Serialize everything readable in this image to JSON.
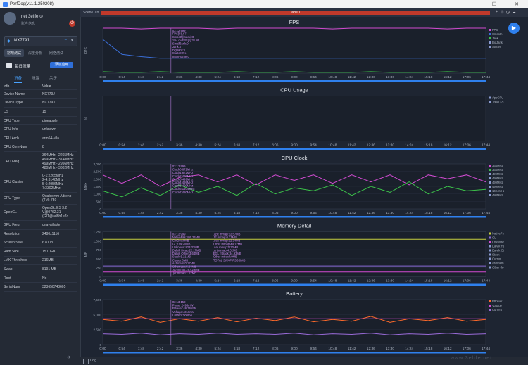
{
  "window": {
    "title": "PerfDog(v11.1.250208)",
    "controls": [
      "—",
      "☐",
      "✕"
    ]
  },
  "user": {
    "name": "net 3elife ⊙",
    "subtitle": "账户信息",
    "logout_icon": "⏻"
  },
  "device": {
    "name": "NX779J",
    "icon": "◆",
    "wifi_icon": "≈",
    "chevron": "▼"
  },
  "mode_tabs": [
    "常规测试",
    "深度分析",
    "网络测试"
  ],
  "app": {
    "name": "每日流量",
    "button": "添加应用"
  },
  "info_tabs": [
    "设备",
    "设置",
    "关于"
  ],
  "info_table": {
    "header": [
      "Info",
      "Value"
    ],
    "rows": [
      [
        "Device Name",
        "NX779J"
      ],
      [
        "Device Type",
        "NX779J"
      ],
      [
        "OS",
        "15"
      ],
      [
        "CPU Type",
        "pineapple"
      ],
      [
        "CPU Info",
        "unknown"
      ],
      [
        "CPU Arch",
        "arm64-v8a"
      ],
      [
        "CPU CoreNum",
        "8"
      ],
      [
        "CPU Freq",
        "364MHz - 2265MHz\n499MHz - 3148MHz\n499MHz - 2956MHz\n480MHz - 3302MHz"
      ],
      [
        "CPU Cluster",
        "0-1:2265MHz\n2-4:3148MHz\n5-6:2956MHz\n7:3302MHz"
      ],
      [
        "GPU Type",
        "Qualcomm Adreno\n(TM) 750"
      ],
      [
        "OpenGL",
        "OpenGL ES 3.2\nV@0762.31\n(GIT@ad8b1e7c"
      ],
      [
        "GPU Freq",
        "unavailable"
      ],
      [
        "Resolution",
        "2480x1116"
      ],
      [
        "Screen Size",
        "6.81 in"
      ],
      [
        "Ram Size",
        "15.0 GB"
      ],
      [
        "LMK Threshold",
        "216MB"
      ],
      [
        "Swap",
        "8191 MB"
      ],
      [
        "Root",
        "No"
      ],
      [
        "SerialNum",
        "323650743605"
      ]
    ]
  },
  "topbar": {
    "scene_tab": "SceneTab",
    "label": "label1"
  },
  "bottom": {
    "log_label": "Log"
  },
  "watermark": "www.3elife.net",
  "colors": {
    "accent": "#2f80ed",
    "label_bar": "#c0392b",
    "fps_line": "#d24bd2",
    "bg": "#1e2532"
  },
  "chart_data": [
    {
      "type": "line",
      "title": "FPS",
      "ylabel": "FPS",
      "ylim": [
        0,
        60
      ],
      "x": [
        "0:00",
        "0:54",
        "1:48",
        "2:42",
        "3:36",
        "4:30",
        "5:24",
        "6:18",
        "7:12",
        "8:06",
        "9:00",
        "9:54",
        "10:48",
        "11:42",
        "12:36",
        "13:30",
        "14:24",
        "15:18",
        "16:12",
        "17:06",
        "17:44"
      ],
      "series": [
        {
          "name": "FPS",
          "color": "#d24bd2",
          "values": [
            60,
            60,
            59,
            60,
            60,
            60,
            59,
            60,
            60,
            60,
            60,
            60,
            59,
            60,
            60,
            60,
            60,
            60,
            59,
            60,
            60
          ]
        },
        {
          "name": "Smooth",
          "color": "#3b6fd8",
          "values": [
            45,
            25,
            22,
            20,
            20,
            20,
            20,
            20,
            20,
            20,
            20,
            20,
            20,
            20,
            20,
            20,
            20,
            20,
            20,
            20,
            20
          ]
        },
        {
          "name": "Jank",
          "color": "#3cc34a",
          "values": [
            2,
            1,
            1,
            2,
            1,
            1,
            1,
            2,
            1,
            1,
            2,
            1,
            1,
            1,
            2,
            1,
            1,
            1,
            2,
            1,
            1
          ]
        }
      ],
      "legend": [
        "FPS",
        "Smooth",
        "Jank",
        "BigJank",
        "Stutter"
      ],
      "readout": [
        "03:12:999",
        "FPS[58.67",
        "Smooth[Index]:0",
        "1%LowFPS[1]:31.86",
        "SmallJank:0",
        "Jank:0",
        "BigJank:0",
        "Stutter:0%",
        "InterFrame:0"
      ]
    },
    {
      "type": "line",
      "title": "CPU Usage",
      "ylabel": "%",
      "x": [
        "0:00",
        "0:54",
        "1:48",
        "2:42",
        "3:36",
        "4:30",
        "5:24",
        "6:18",
        "7:12",
        "8:06",
        "9:00",
        "9:54",
        "10:48",
        "11:42",
        "12:36",
        "13:30",
        "14:24",
        "15:18",
        "16:12",
        "17:06",
        "17:44"
      ],
      "series": [],
      "legend": [
        "AppCPU",
        "TotalCPU"
      ]
    },
    {
      "type": "line",
      "title": "CPU Clock",
      "ylabel": "MHz",
      "ylim": [
        0,
        3000
      ],
      "yticks": [
        "3,000",
        "2,500",
        "2,000",
        "1,500",
        "1,000",
        "500",
        "0"
      ],
      "x": [
        "0:00",
        "0:54",
        "1:48",
        "2:42",
        "3:36",
        "4:30",
        "5:24",
        "6:18",
        "7:12",
        "8:06",
        "9:00",
        "9:54",
        "10:48",
        "11:42",
        "12:36",
        "13:30",
        "14:24",
        "15:18",
        "16:12",
        "17:06",
        "17:44"
      ],
      "series": [
        {
          "name": "CPU0",
          "color": "#d24bd2",
          "values": [
            2265,
            1700,
            2265,
            1500,
            2100,
            2265,
            1800,
            2265,
            1600,
            2265,
            1900,
            2265,
            1700,
            2265,
            1800,
            2265,
            1600,
            2265,
            2000,
            2265,
            1800
          ]
        },
        {
          "name": "CPU2",
          "color": "#3cc34a",
          "values": [
            1200,
            800,
            1400,
            900,
            1600,
            1100,
            1500,
            900,
            1700,
            1000,
            1400,
            1200,
            1600,
            900,
            1500,
            1100,
            1800,
            1000,
            1500,
            1200,
            1300
          ]
        }
      ],
      "legend": [
        "364MHz",
        "364MHz",
        "499MHz",
        "499MHz",
        "499MHz",
        "499MHz",
        "1404MHz",
        "480MHz"
      ],
      "readout": [
        "03:12:999",
        "Clock0:672MHz",
        "Clock1:672MHz",
        "Clock2:499MHz",
        "Clock3:499MHz",
        "Clock4:499MHz",
        "Clock5:499MHz",
        "Clock6:1404MHz",
        "Clock7:480MHz"
      ]
    },
    {
      "type": "line",
      "title": "Memory Detail",
      "ylabel": "MB",
      "ylim": [
        0,
        1250
      ],
      "yticks": [
        "1,250",
        "1,000",
        "750",
        "500",
        "250",
        "0"
      ],
      "x": [
        "0:00",
        "0:54",
        "1:48",
        "2:42",
        "3:36",
        "4:30",
        "5:24",
        "6:18",
        "7:12",
        "8:06",
        "9:00",
        "9:54",
        "10:48",
        "11:42",
        "12:36",
        "13:30",
        "14:24",
        "15:18",
        "16:12",
        "17:06",
        "17:44"
      ],
      "series": [
        {
          "name": "NativePss",
          "color": "#c8d040",
          "values": [
            1040,
            1040,
            1040,
            1040,
            1040,
            1040,
            1040,
            1040,
            1040,
            1040,
            1040,
            1040,
            1040,
            1040,
            1040,
            1040,
            1040,
            1040,
            1040,
            1040,
            1040
          ]
        },
        {
          "name": "GL",
          "color": "#8a6bd8",
          "values": [
            300,
            300,
            300,
            300,
            300,
            300,
            300,
            300,
            300,
            300,
            300,
            300,
            300,
            300,
            300,
            300,
            300,
            300,
            300,
            300,
            300
          ]
        },
        {
          "name": "Unknown",
          "color": "#d24bd2",
          "values": [
            130,
            130,
            130,
            130,
            130,
            130,
            130,
            130,
            130,
            130,
            130,
            130,
            130,
            130,
            130,
            130,
            130,
            130,
            130,
            130,
            130
          ]
        }
      ],
      "legend": [
        "NativePss",
        "GL",
        "Unknown",
        "Dalvik Heap",
        "Dalvik Other",
        "Stack",
        "Cursor",
        "Ashmem",
        "Other dev"
      ],
      "readout": [
        "03:12:999",
        "NativePss:105.24MB",
        "GfxDev:0MB",
        "GL:119.20MB",
        "Unknown:823.32MB",
        "Dalvik Heap:22.27MB",
        "Dalvik Other:3.64MB",
        "Stack:5.21MB",
        "Cursor:0MB",
        "Ashmem:0.17MB",
        "Other dev:5.64MB",
        ".so mmap:297.29MB",
        ".jar mmap:1.72MB",
        ".apk mmap:12.57MB",
        ".ttf mmap:0.31MB",
        ".dex mmap:12.34MB",
        "Other mmap:49.12MB",
        ".oat mmap:0.30MB",
        ".art mmap:4.02MB",
        "EGL mtrack:84.93MB",
        "Other mtrack:0MB",
        "TOTAL SWAP PSS:0MB"
      ]
    },
    {
      "type": "line",
      "title": "Battery",
      "ylim": [
        0,
        7500
      ],
      "yticks": [
        "7,500",
        "5,000",
        "2,500",
        "0"
      ],
      "x": [
        "0:00",
        "0:54",
        "1:48",
        "2:42",
        "3:36",
        "4:30",
        "5:24",
        "6:18",
        "7:12",
        "8:06",
        "9:00",
        "9:54",
        "10:48",
        "11:42",
        "12:36",
        "13:30",
        "14:24",
        "15:18",
        "16:12",
        "17:06",
        "17:44"
      ],
      "series": [
        {
          "name": "Power",
          "color": "#ff6a2a",
          "values": [
            4200,
            3900,
            4600,
            3700,
            4300,
            3900,
            4500,
            3800,
            4400,
            4000,
            4600,
            3800,
            4200,
            3900,
            4700,
            3700,
            4300,
            4000,
            4500,
            3900,
            4200
          ]
        },
        {
          "name": "Voltage",
          "color": "#d24bd2",
          "values": [
            4310,
            4310,
            4310,
            4310,
            4310,
            4310,
            4310,
            4310,
            4310,
            4310,
            4310,
            4310,
            4310,
            4310,
            4310,
            4310,
            4310,
            4310,
            4310,
            4310,
            4310
          ]
        },
        {
          "name": "Current",
          "color": "#9a6bd8",
          "values": [
            1800,
            1700,
            1900,
            1600,
            1800,
            1700,
            1900,
            1700,
            1800,
            1700,
            1900,
            1600,
            1800,
            1700,
            1900,
            1600,
            1800,
            1700,
            1900,
            1700,
            1800
          ]
        }
      ],
      "legend": [
        "FPower",
        "Voltage",
        "Current"
      ],
      "readout": [
        "03:13:158",
        "Power:2495mW",
        "FPower:46.76mW",
        "Voltage:4310mV",
        "Current:580mA"
      ]
    }
  ]
}
